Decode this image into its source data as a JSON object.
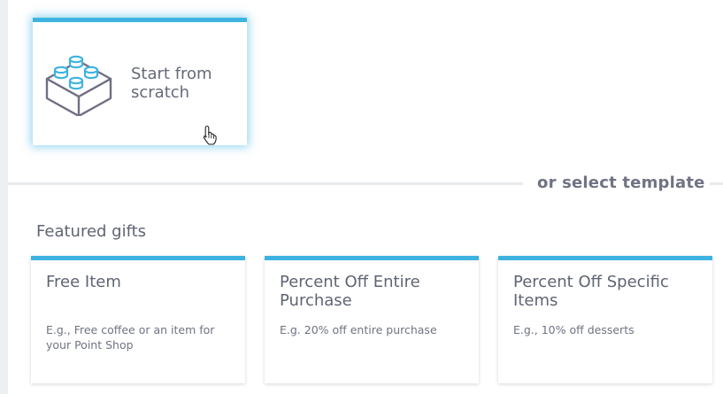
{
  "scratch": {
    "label": "Start from scratch",
    "icon": "lego-brick-icon"
  },
  "divider": {
    "text": "or select template"
  },
  "featured": {
    "title": "Featured gifts",
    "cards": [
      {
        "title": "Free Item",
        "description": "E.g., Free coffee or an item for your Point Shop"
      },
      {
        "title": "Percent Off Entire Purchase",
        "description": "E.g. 20% off entire purchase"
      },
      {
        "title": "Percent Off Specific Items",
        "description": "E.g., 10% off desserts"
      }
    ]
  },
  "colors": {
    "accent": "#3eb3e0",
    "text": "#5f6473",
    "divider": "#e7eaed"
  }
}
